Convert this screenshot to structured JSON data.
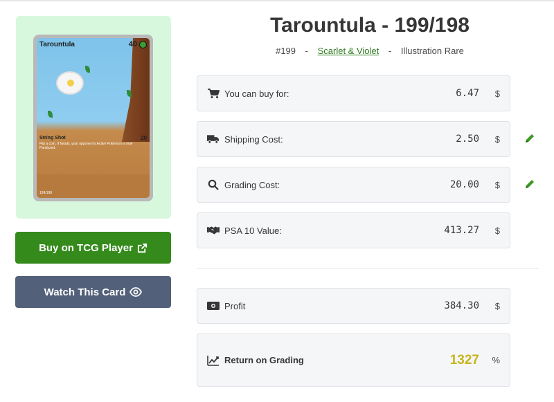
{
  "card": {
    "name": "Tarountula",
    "hp": "40",
    "attack_name": "String Shot",
    "attack_damage": "20",
    "attack_text": "Flip a coin. If heads, your opponent's Active Pokémon is now Paralyzed.",
    "set_number": "199/198"
  },
  "buttons": {
    "buy_label": "Buy on TCG Player",
    "watch_label": "Watch This Card"
  },
  "header": {
    "title": "Tarountula - 199/198",
    "number": "#199",
    "separator": "-",
    "set_name": "Scarlet & Violet",
    "rarity": "Illustration Rare"
  },
  "rows": [
    {
      "label": "You can buy for:",
      "value": "6.47",
      "unit": "$",
      "icon": "cart-icon"
    },
    {
      "label": "Shipping Cost:",
      "value": "2.50",
      "unit": "$",
      "icon": "truck-icon"
    },
    {
      "label": "Grading Cost:",
      "value": "20.00",
      "unit": "$",
      "icon": "search-icon"
    },
    {
      "label": "PSA 10 Value:",
      "value": "413.27",
      "unit": "$",
      "icon": "handshake-icon"
    }
  ],
  "summary": {
    "profit": {
      "label": "Profit",
      "value": "384.30",
      "unit": "$",
      "icon": "money-bill-icon"
    },
    "roi": {
      "label": "Return on Grading",
      "value": "1327",
      "unit": "%",
      "icon": "chart-line-icon"
    }
  },
  "colors": {
    "buy_button": "#358a1c",
    "watch_button": "#536079",
    "roi_value": "#c6b51b",
    "edit_icon": "#3a9a24",
    "card_frame": "#d8f8de"
  }
}
